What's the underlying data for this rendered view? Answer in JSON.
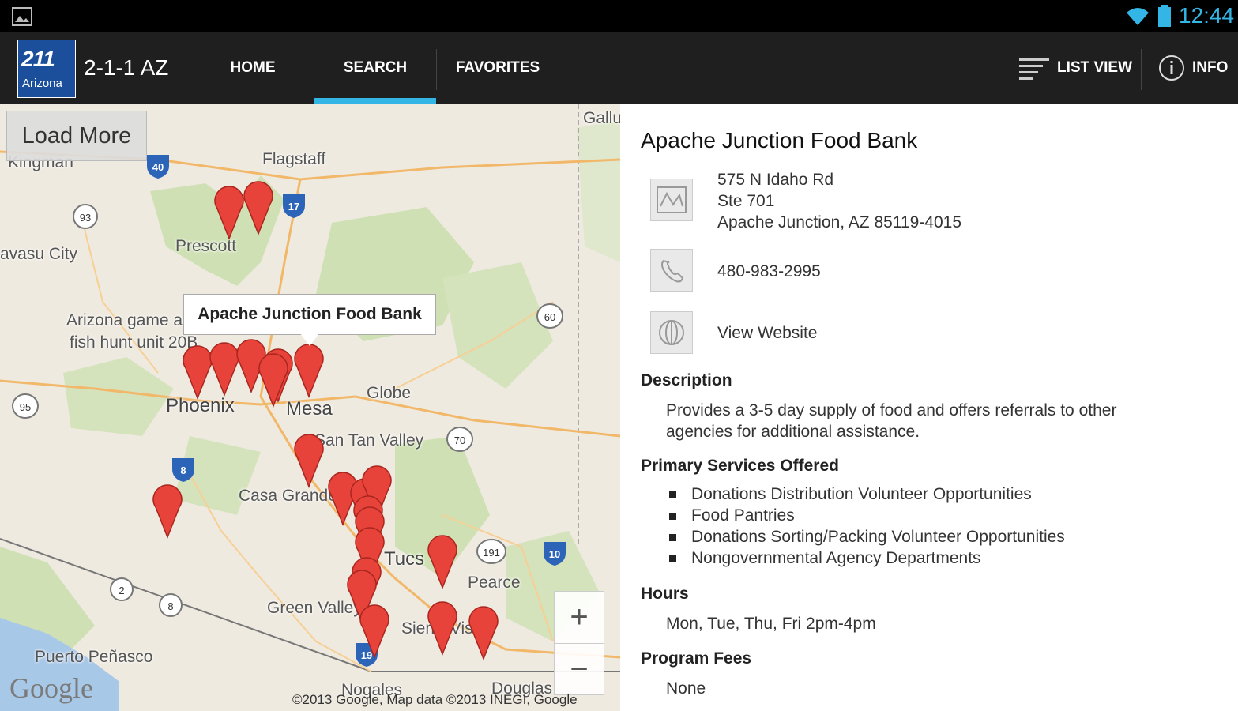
{
  "statusbar": {
    "time": "12:44"
  },
  "actionbar": {
    "logo_big": "211",
    "logo_small": "Arizona",
    "title": "2-1-1 AZ",
    "tabs": [
      {
        "label": "HOME"
      },
      {
        "label": "SEARCH"
      },
      {
        "label": "FAVORITES"
      }
    ],
    "selected_tab": "SEARCH",
    "list_view_label": "LIST VIEW",
    "info_label": "INFO"
  },
  "map": {
    "load_more_label": "Load More",
    "callout": "Apache Junction Food Bank",
    "zoom_in": "+",
    "zoom_out": "−",
    "google_logo": "Google",
    "copyright": "©2013 Google, Map data ©2013 INEGI, Google",
    "labels": {
      "kingman": "Kingman",
      "flagstaff": "Flagstaff",
      "prescott": "Prescott",
      "lake_havasu": "avasu City",
      "gallup": "Gallu",
      "game_unit": "Arizona game a",
      "fish_hunt": "fish hunt unit 20B",
      "phoenix": "Phoenix",
      "mesa": "Mesa",
      "globe": "Globe",
      "san_tan": "San Tan Valley",
      "casa_grande": "Casa Grande",
      "tucson": "Tucs",
      "pearce": "Pearce",
      "green_valley": "Green Valley",
      "sierra_vista": "Sierra Vis",
      "puerto_penasco": "Puerto Peñasco",
      "nogales": "Nogales",
      "douglas": "Douglas"
    },
    "shields": [
      "40",
      "93",
      "17",
      "60",
      "95",
      "70",
      "8",
      "191",
      "10",
      "2",
      "8",
      "19"
    ],
    "pin_color": "#e8433a"
  },
  "detail": {
    "title": "Apache Junction Food Bank",
    "address_lines": [
      "575 N Idaho Rd",
      "Ste 701",
      "Apache Junction, AZ 85119-4015"
    ],
    "phone": "480-983-2995",
    "website_label": "View Website",
    "description_heading": "Description",
    "description_line1": "Provides a 3-5 day supply of food and offers referrals to other",
    "description_line2": "agencies for additional assistance.",
    "services_heading": "Primary Services Offered",
    "services": [
      "Donations Distribution Volunteer Opportunities",
      "Food Pantries",
      "Donations Sorting/Packing Volunteer Opportunities",
      "Nongovernmental Agency Departments"
    ],
    "hours_heading": "Hours",
    "hours": "Mon, Tue, Thu, Fri 2pm-4pm",
    "fees_heading": "Program Fees",
    "fees": "None"
  },
  "colors": {
    "accent": "#33b5e5",
    "actionbar": "#1f1f1f",
    "statusbar": "#000000"
  }
}
